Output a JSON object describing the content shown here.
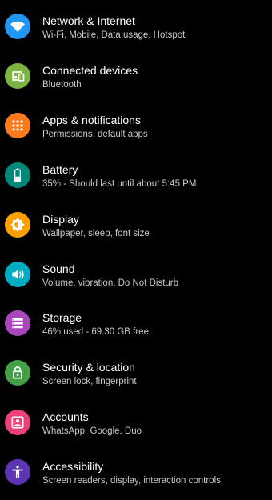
{
  "settings": {
    "items": [
      {
        "title": "Network & Internet",
        "subtitle": "Wi-Fi, Mobile, Data usage, Hotspot",
        "icon": "wifi-icon",
        "color": "#2196F3"
      },
      {
        "title": "Connected devices",
        "subtitle": "Bluetooth",
        "icon": "devices-icon",
        "color": "#7CB342"
      },
      {
        "title": "Apps & notifications",
        "subtitle": "Permissions, default apps",
        "icon": "apps-grid-icon",
        "color": "#FF7A1A"
      },
      {
        "title": "Battery",
        "subtitle": "35% - Should last until about 5:45 PM",
        "icon": "battery-icon",
        "color": "#00897B"
      },
      {
        "title": "Display",
        "subtitle": "Wallpaper, sleep, font size",
        "icon": "brightness-icon",
        "color": "#FFA000"
      },
      {
        "title": "Sound",
        "subtitle": "Volume, vibration, Do Not Disturb",
        "icon": "volume-icon",
        "color": "#00ACC1"
      },
      {
        "title": "Storage",
        "subtitle": "46% used - 69.30 GB free",
        "icon": "storage-icon",
        "color": "#AB47BC"
      },
      {
        "title": "Security & location",
        "subtitle": "Screen lock, fingerprint",
        "icon": "lock-icon",
        "color": "#43A047"
      },
      {
        "title": "Accounts",
        "subtitle": "WhatsApp, Google, Duo",
        "icon": "account-icon",
        "color": "#EC407A"
      },
      {
        "title": "Accessibility",
        "subtitle": "Screen readers, display, interaction controls",
        "icon": "accessibility-icon",
        "color": "#5E35B1"
      }
    ]
  }
}
